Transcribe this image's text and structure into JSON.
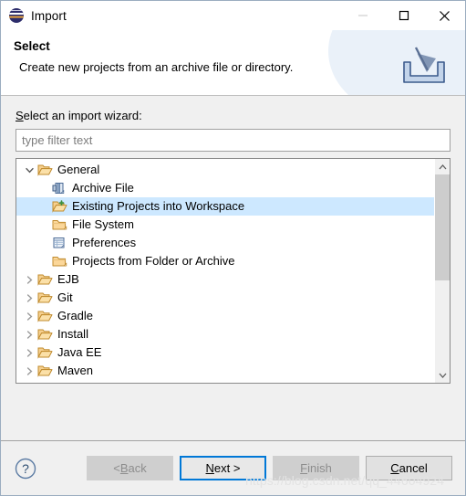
{
  "window": {
    "title": "Import",
    "app_icon": "eclipse-logo-icon",
    "controls": {
      "minimize": "minimize-icon",
      "maximize": "maximize-icon",
      "close": "close-icon"
    }
  },
  "header": {
    "title": "Select",
    "description": "Create new projects from an archive file or directory.",
    "banner_icon": "import-tray-arrow-icon"
  },
  "content": {
    "wizard_label_prefix": "S",
    "wizard_label_rest": "elect an import wizard:",
    "filter": {
      "placeholder": "type filter text",
      "value": ""
    },
    "tree": {
      "items": [
        {
          "label": "General",
          "level": 0,
          "state": "expanded",
          "icon": "folder-open-icon",
          "selected": false
        },
        {
          "label": "Archive File",
          "level": 1,
          "state": "leaf",
          "icon": "archive-file-icon",
          "selected": false
        },
        {
          "label": "Existing Projects into Workspace",
          "level": 1,
          "state": "leaf",
          "icon": "import-projects-folder-icon",
          "selected": true
        },
        {
          "label": "File System",
          "level": 1,
          "state": "leaf",
          "icon": "folder-icon",
          "selected": false
        },
        {
          "label": "Preferences",
          "level": 1,
          "state": "leaf",
          "icon": "preferences-icon",
          "selected": false
        },
        {
          "label": "Projects from Folder or Archive",
          "level": 1,
          "state": "leaf",
          "icon": "folder-icon",
          "selected": false
        },
        {
          "label": "EJB",
          "level": 0,
          "state": "collapsed",
          "icon": "folder-open-icon",
          "selected": false
        },
        {
          "label": "Git",
          "level": 0,
          "state": "collapsed",
          "icon": "folder-open-icon",
          "selected": false
        },
        {
          "label": "Gradle",
          "level": 0,
          "state": "collapsed",
          "icon": "folder-open-icon",
          "selected": false
        },
        {
          "label": "Install",
          "level": 0,
          "state": "collapsed",
          "icon": "folder-open-icon",
          "selected": false
        },
        {
          "label": "Java EE",
          "level": 0,
          "state": "collapsed",
          "icon": "folder-open-icon",
          "selected": false
        },
        {
          "label": "Maven",
          "level": 0,
          "state": "collapsed",
          "icon": "folder-open-icon",
          "selected": false
        }
      ],
      "scrollbar": {
        "up_arrow": "chevron-up-icon",
        "down_arrow": "chevron-down-icon",
        "thumb_fraction": 0.55
      }
    }
  },
  "footer": {
    "help": "help-icon",
    "buttons": [
      {
        "label_prefix": "< ",
        "mnemonic": "B",
        "label_suffix": "ack",
        "state": "disabled",
        "name": "back-button"
      },
      {
        "label_prefix": "",
        "mnemonic": "N",
        "label_suffix": "ext >",
        "state": "focused",
        "name": "next-button"
      },
      {
        "label_prefix": "",
        "mnemonic": "F",
        "label_suffix": "inish",
        "state": "disabled",
        "name": "finish-button"
      },
      {
        "label_prefix": "",
        "mnemonic": "C",
        "label_suffix": "ancel",
        "state": "enabled",
        "name": "cancel-button"
      }
    ]
  },
  "watermark": "https://blog.csdn.net/qq_44604924",
  "colors": {
    "selection": "#cde8ff",
    "focus_border": "#0078d7",
    "dialog_bg": "#f0f0f0",
    "folder": "#f5c87d"
  }
}
